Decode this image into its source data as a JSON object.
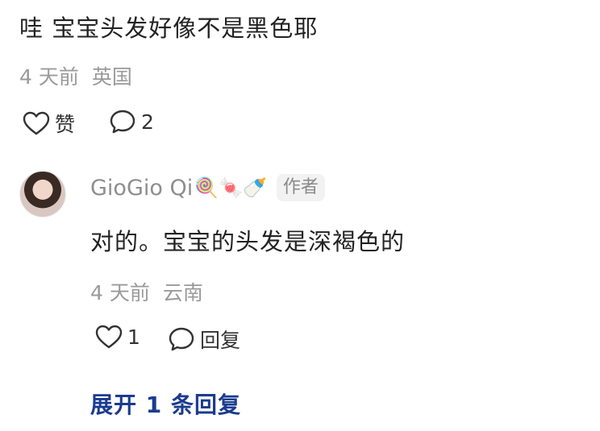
{
  "comment": {
    "text": "哇 宝宝头发好像不是黑色耶",
    "time": "4 天前",
    "location": "英国",
    "like_label": "赞",
    "reply_count": "2"
  },
  "reply": {
    "author": "GioGio Qi",
    "author_emojis": "🍭🍬🍼",
    "badge": "作者",
    "text": "对的。宝宝的头发是深褐色的",
    "time": "4 天前",
    "location": "云南",
    "like_count": "1",
    "reply_label": "回复"
  },
  "expand_label": "展开 1 条回复"
}
